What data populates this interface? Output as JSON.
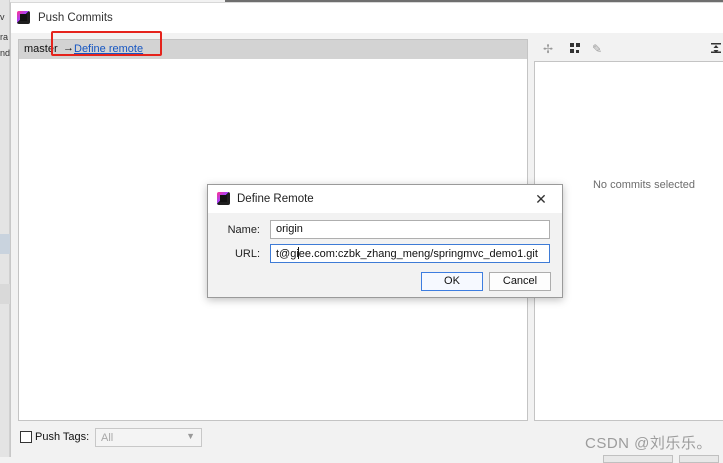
{
  "window": {
    "title": "Push Commits"
  },
  "ide_background": {
    "left_fragments": [
      "v",
      "ra",
      "nd"
    ]
  },
  "repo": {
    "branch": "master",
    "arrow": "→",
    "define_remote_link": "Define remote"
  },
  "details": {
    "empty_text": "No commits selected"
  },
  "bottom": {
    "push_tags_label": "Push Tags:",
    "push_tags_checked": false,
    "tags_select_value": "All"
  },
  "watermark": "CSDN @刘乐乐。",
  "modal": {
    "title": "Define Remote",
    "close_glyph": "✕",
    "name_label": "Name:",
    "name_value": "origin",
    "url_label": "URL:",
    "url_before_caret": "t@gi",
    "url_after_caret": "ee.com:czbk_zhang_meng/springmvc_demo1.git",
    "ok_label": "OK",
    "cancel_label": "Cancel"
  },
  "colors": {
    "link": "#1656c2",
    "highlight": "#e5231c",
    "focus": "#3e7bd6"
  },
  "icons": {
    "toolbar": [
      "pin-icon",
      "group-icon",
      "edit-icon",
      "expand-icon"
    ]
  }
}
